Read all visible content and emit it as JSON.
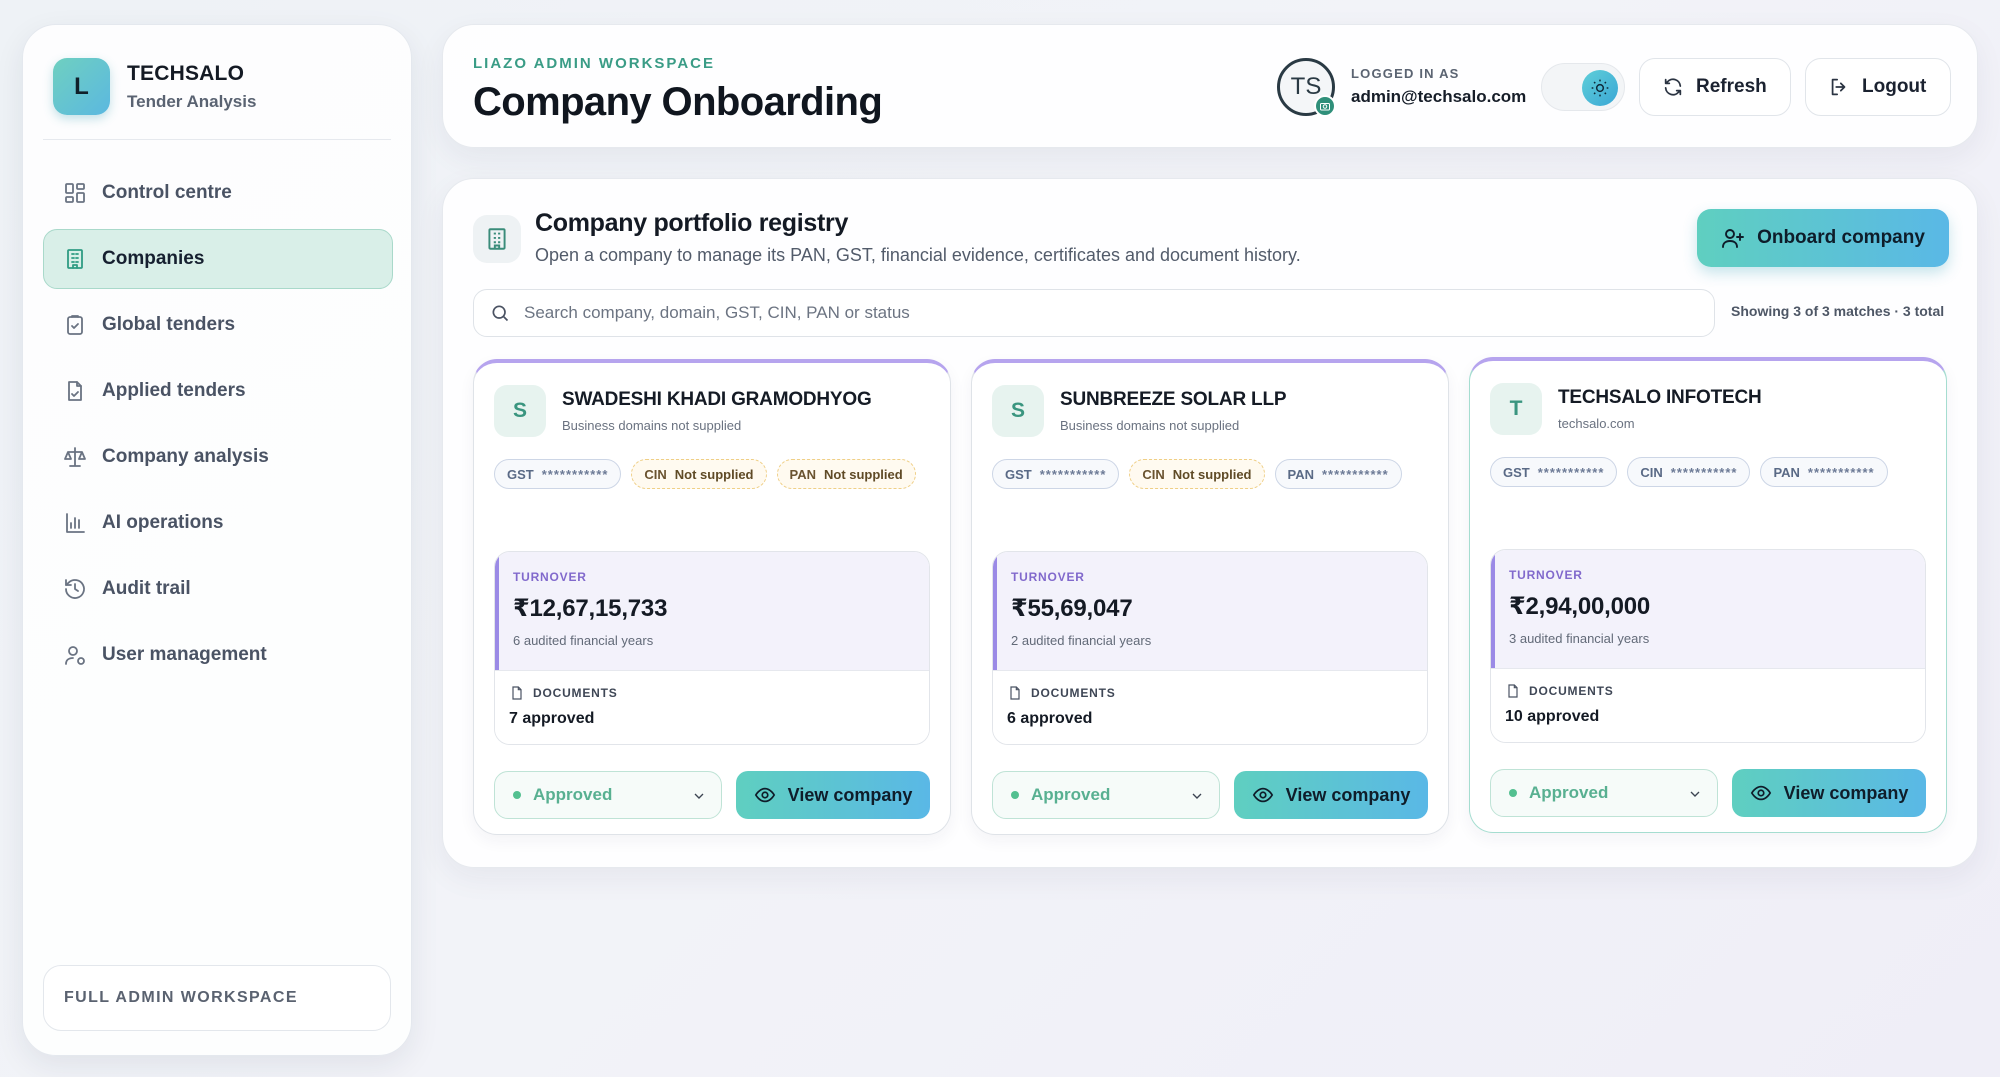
{
  "brand": {
    "initial": "L",
    "name": "TECHSALO",
    "subtitle": "Tender Analysis"
  },
  "nav": [
    {
      "label": "Control centre",
      "icon": "dashboard-icon",
      "active": false
    },
    {
      "label": "Companies",
      "icon": "building-icon",
      "active": true
    },
    {
      "label": "Global tenders",
      "icon": "clipboard-check-icon",
      "active": false
    },
    {
      "label": "Applied tenders",
      "icon": "file-icon",
      "active": false
    },
    {
      "label": "Company analysis",
      "icon": "scale-icon",
      "active": false
    },
    {
      "label": "AI operations",
      "icon": "bar-chart-icon",
      "active": false
    },
    {
      "label": "Audit trail",
      "icon": "history-icon",
      "active": false
    },
    {
      "label": "User management",
      "icon": "user-gear-icon",
      "active": false
    }
  ],
  "sidebar_footer": "FULL ADMIN WORKSPACE",
  "header": {
    "eyebrow": "LIAZO ADMIN WORKSPACE",
    "title": "Company Onboarding",
    "user_initials": "TS",
    "logged_in_label": "LOGGED IN AS",
    "email": "admin@techsalo.com",
    "theme": "light",
    "refresh_label": "Refresh",
    "logout_label": "Logout"
  },
  "registry": {
    "title": "Company portfolio registry",
    "subtitle": "Open a company to manage its PAN, GST, financial evidence, certificates and document history.",
    "onboard_label": "Onboard company",
    "search_placeholder": "Search company, domain, GST, CIN, PAN or status",
    "search_value": "",
    "match_count": "Showing 3 of 3 matches · 3 total"
  },
  "companies": [
    {
      "initial": "S",
      "name": "SWADESHI KHADI GRAMODHYOG",
      "domain": "Business domains not supplied",
      "tags": [
        {
          "key": "GST",
          "value": "***********",
          "state": "masked"
        },
        {
          "key": "CIN",
          "value": "Not supplied",
          "state": "missing"
        },
        {
          "key": "PAN",
          "value": "Not supplied",
          "state": "missing"
        }
      ],
      "turnover_label": "TURNOVER",
      "turnover": "₹12,67,15,733",
      "years": "6 audited financial years",
      "docs_label": "DOCUMENTS",
      "docs": "7 approved",
      "status": "Approved",
      "view_label": "View company"
    },
    {
      "initial": "S",
      "name": "SUNBREEZE SOLAR LLP",
      "domain": "Business domains not supplied",
      "tags": [
        {
          "key": "GST",
          "value": "***********",
          "state": "masked"
        },
        {
          "key": "CIN",
          "value": "Not supplied",
          "state": "missing"
        },
        {
          "key": "PAN",
          "value": "***********",
          "state": "masked"
        }
      ],
      "turnover_label": "TURNOVER",
      "turnover": "₹55,69,047",
      "years": "2 audited financial years",
      "docs_label": "DOCUMENTS",
      "docs": "6 approved",
      "status": "Approved",
      "view_label": "View company"
    },
    {
      "initial": "T",
      "name": "TECHSALO INFOTECH",
      "domain": "techsalo.com",
      "tags": [
        {
          "key": "GST",
          "value": "***********",
          "state": "masked"
        },
        {
          "key": "CIN",
          "value": "***********",
          "state": "masked"
        },
        {
          "key": "PAN",
          "value": "***********",
          "state": "masked"
        }
      ],
      "turnover_label": "TURNOVER",
      "turnover": "₹2,94,00,000",
      "years": "3 audited financial years",
      "docs_label": "DOCUMENTS",
      "docs": "10 approved",
      "status": "Approved",
      "view_label": "View company"
    }
  ],
  "colors": {
    "accent": "#3a9c86",
    "active_nav_bg": "#d9efe8",
    "turnover_accent": "#9b8ae6",
    "approved": "#58b091",
    "button_gradient_start": "#5fcfc0",
    "button_gradient_end": "#5ab8e6"
  }
}
